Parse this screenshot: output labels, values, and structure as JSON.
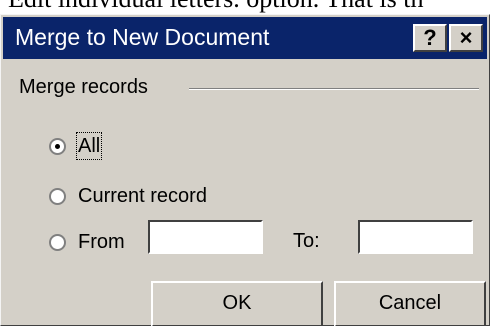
{
  "background": {
    "text": "Edit individual letters. option. That is th"
  },
  "window": {
    "title": "Merge to New Document",
    "help_icon": "help-icon",
    "close_icon": "close-icon",
    "help_glyph": "?",
    "close_glyph": "×"
  },
  "group": {
    "label": "Merge records"
  },
  "options": {
    "all": {
      "label": "All",
      "checked": true
    },
    "current_record": {
      "label": "Current record",
      "checked": false
    },
    "from": {
      "label": "From",
      "checked": false,
      "value": ""
    }
  },
  "to": {
    "label": "To:",
    "value": ""
  },
  "buttons": {
    "ok": "OK",
    "cancel": "Cancel"
  }
}
